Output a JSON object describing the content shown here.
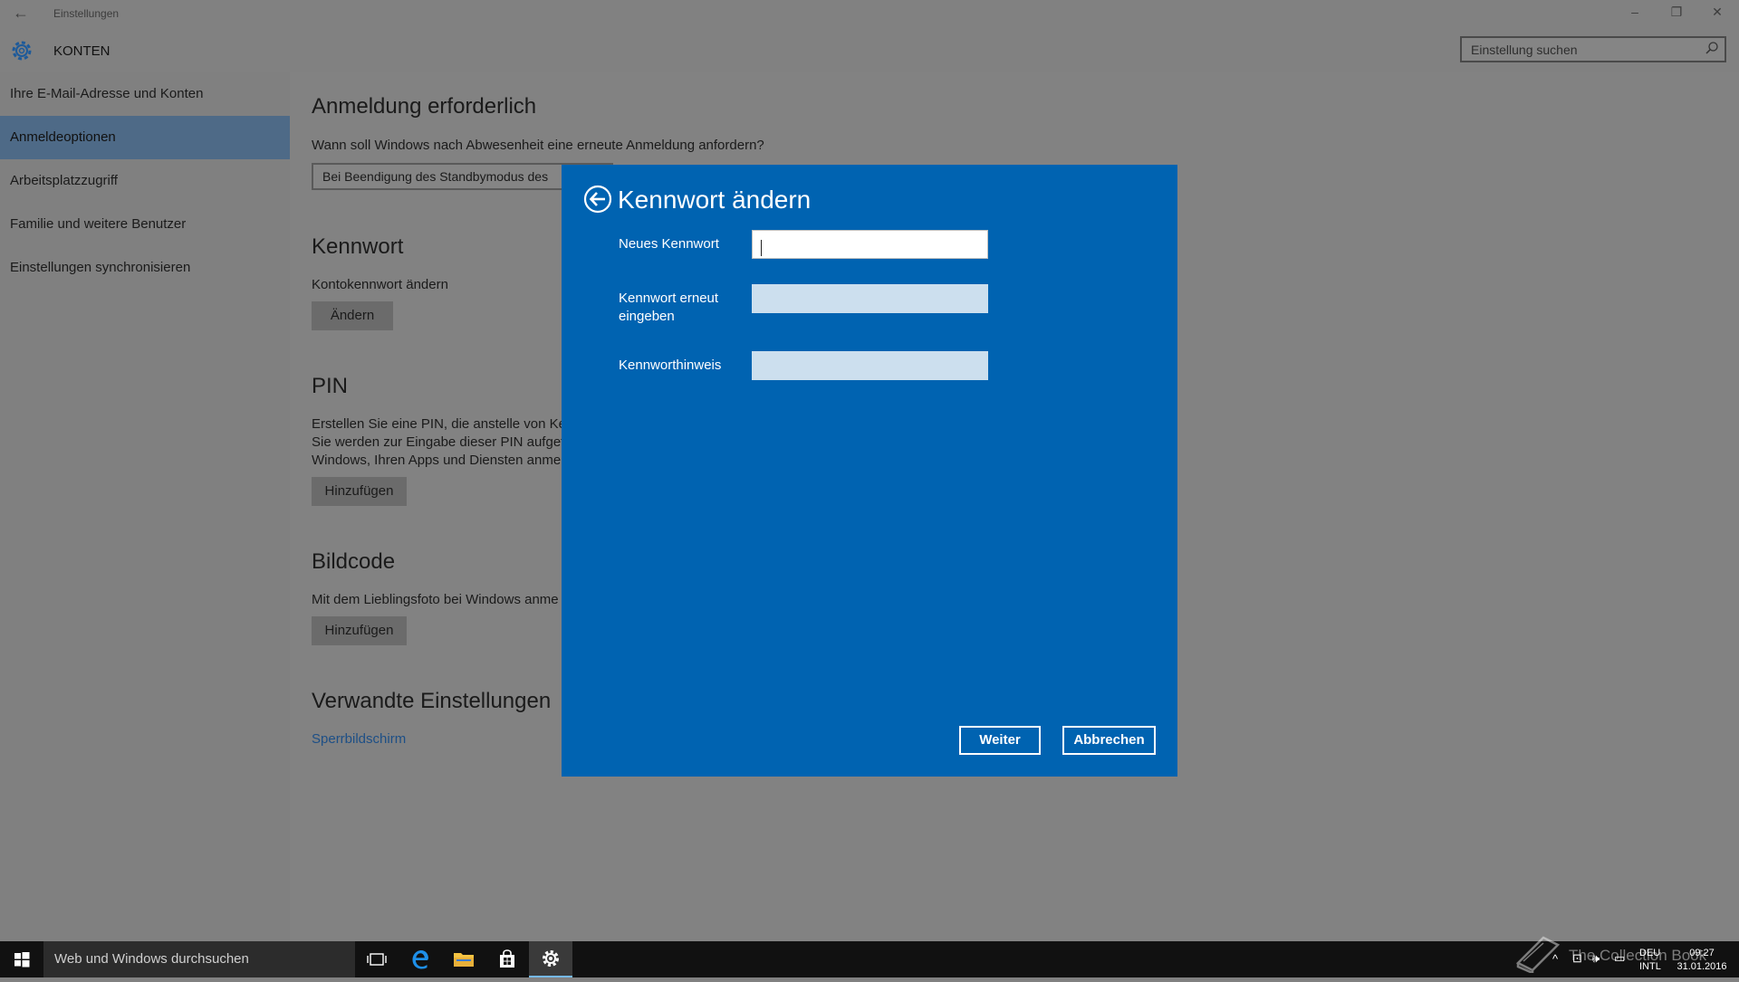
{
  "window": {
    "title": "Einstellungen",
    "section": "KONTEN",
    "search_placeholder": "Einstellung suchen",
    "controls": {
      "minimize": "–",
      "restore": "❐",
      "close": "✕"
    }
  },
  "sidebar": {
    "items": [
      {
        "label": "Ihre E-Mail-Adresse und Konten"
      },
      {
        "label": "Anmeldeoptionen",
        "active": true
      },
      {
        "label": "Arbeitsplatzzugriff"
      },
      {
        "label": "Familie und weitere Benutzer"
      },
      {
        "label": "Einstellungen synchronisieren"
      }
    ]
  },
  "main": {
    "signin": {
      "heading": "Anmeldung erforderlich",
      "question": "Wann soll Windows nach Abwesenheit eine erneute Anmeldung anfordern?",
      "dropdown_value": "Bei Beendigung des Standbymodus des"
    },
    "password": {
      "heading": "Kennwort",
      "desc": "Kontokennwort ändern",
      "button": "Ändern"
    },
    "pin": {
      "heading": "PIN",
      "line1": "Erstellen Sie eine PIN, die anstelle von Ker",
      "line2": "Sie werden zur Eingabe dieser PIN aufgefo",
      "line3": "Windows, Ihren Apps und Diensten anmel",
      "button": "Hinzufügen"
    },
    "picture": {
      "heading": "Bildcode",
      "desc": "Mit dem Lieblingsfoto bei Windows anme",
      "button": "Hinzufügen"
    },
    "related": {
      "heading": "Verwandte Einstellungen",
      "link": "Sperrbildschirm"
    }
  },
  "dialog": {
    "title": "Kennwort ändern",
    "fields": [
      {
        "label": "Neues Kennwort",
        "value": ""
      },
      {
        "label": "Kennwort erneut eingeben",
        "value": ""
      },
      {
        "label": "Kennworthinweis",
        "value": ""
      }
    ],
    "next_button": "Weiter",
    "cancel_button": "Abbrechen"
  },
  "taskbar": {
    "search_text": "Web und Windows durchsuchen",
    "language": "DEU",
    "keyboard": "INTL",
    "time": "09:27",
    "date": "31.01.2016",
    "watermark": "The Collection Book"
  },
  "colors": {
    "dialog_bg": "#0063b1",
    "active_item": "#4e6a87",
    "link": "#1d4f86"
  }
}
